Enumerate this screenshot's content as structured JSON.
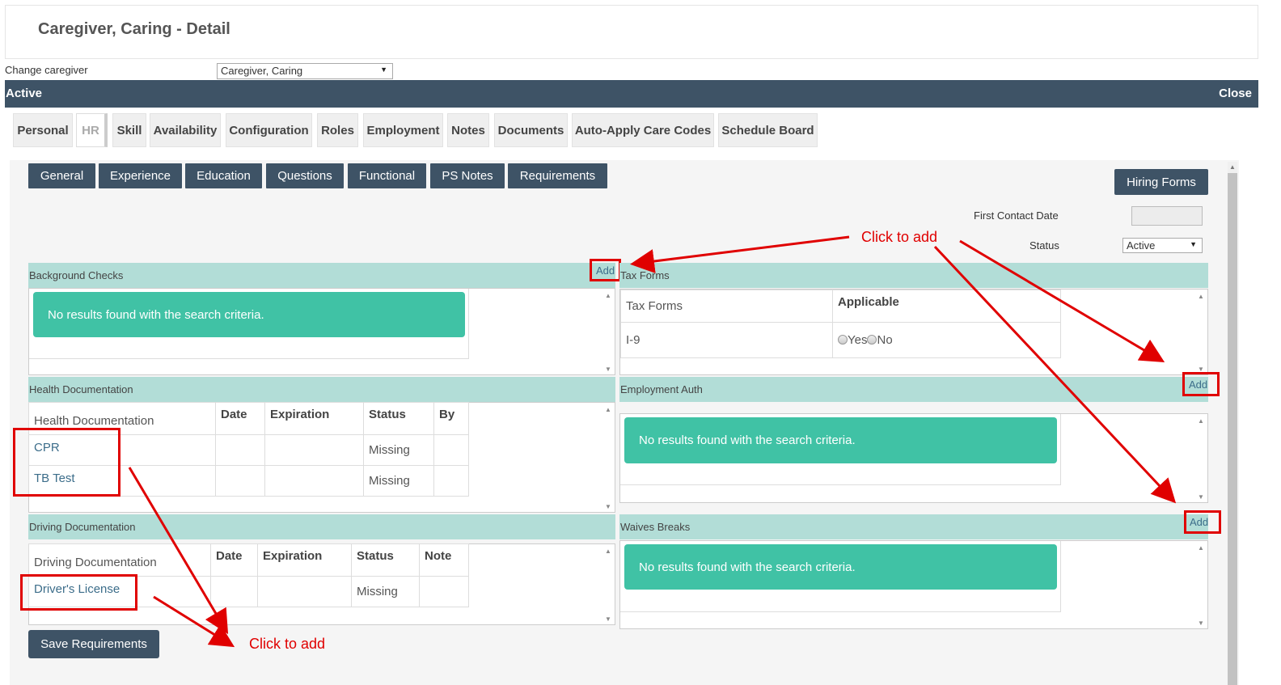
{
  "header": {
    "title": "Caregiver, Caring - Detail"
  },
  "change_caregiver": {
    "label": "Change caregiver",
    "selected": "Caregiver, Caring"
  },
  "status_bar": {
    "left": "Active",
    "right": "Close"
  },
  "main_tabs": [
    "Personal",
    "HR",
    "Skill",
    "Availability",
    "Configuration",
    "Roles",
    "Employment",
    "Notes",
    "Documents",
    "Auto-Apply Care Codes",
    "Schedule Board"
  ],
  "sub_tabs": [
    "General",
    "Experience",
    "Education",
    "Questions",
    "Functional",
    "PS Notes",
    "Requirements"
  ],
  "hiring_forms": "Hiring Forms",
  "first_contact_date": {
    "label": "First Contact Date",
    "value": ""
  },
  "status": {
    "label": "Status",
    "selected": "Active"
  },
  "add_label": "Add",
  "no_results": "No results found with the search criteria.",
  "background_checks": {
    "title": "Background Checks"
  },
  "tax_forms": {
    "title": "Tax Forms",
    "columns": [
      "Tax Forms",
      "Applicable"
    ],
    "rows": [
      {
        "name": "I-9",
        "yes": "Yes",
        "no": "No"
      }
    ]
  },
  "health_documentation": {
    "title": "Health Documentation",
    "columns": [
      "Health Documentation",
      "Date",
      "Expiration",
      "Status",
      "By"
    ],
    "rows": [
      {
        "name": "CPR",
        "date": "",
        "expiration": "",
        "status": "Missing",
        "by": ""
      },
      {
        "name": "TB Test",
        "date": "",
        "expiration": "",
        "status": "Missing",
        "by": ""
      }
    ]
  },
  "employment_auth": {
    "title": "Employment Auth"
  },
  "driving_documentation": {
    "title": "Driving Documentation",
    "columns": [
      "Driving Documentation",
      "Date",
      "Expiration",
      "Status",
      "Note"
    ],
    "rows": [
      {
        "name": "Driver's License",
        "date": "",
        "expiration": "",
        "status": "Missing",
        "note": ""
      }
    ]
  },
  "waives_breaks": {
    "title": "Waives Breaks"
  },
  "save_button": "Save Requirements",
  "annotations": {
    "top": "Click to add",
    "bottom": "Click to add"
  },
  "colors": {
    "nav": "#3e5366",
    "section_header": "#b2ddd7",
    "no_results": "#40c2a5",
    "annotation": "#e00000"
  }
}
